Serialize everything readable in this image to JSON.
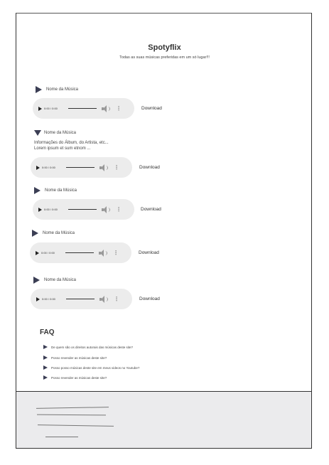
{
  "header": {
    "title": "Spotyflix",
    "subtitle": "Todas as suas músicas preferidas em um só lugar!!!"
  },
  "tracks": [
    {
      "name": "Nome da Música",
      "time": "0:00 / 0:00",
      "download": "Download"
    },
    {
      "name": "Nome da Música",
      "info_line1": "Informações do Álbum, do Artista, etc...",
      "info_line2": "Lorem ipsum et sum etnom ...",
      "time": "0:00 / 0:00",
      "download": "Download"
    },
    {
      "name": "Nome da Música",
      "time": "0:00 / 0:00",
      "download": "Download"
    },
    {
      "name": "Nome da Música",
      "time": "0:00 / 0:00",
      "download": "Download"
    },
    {
      "name": "Nome da Música",
      "time": "0:00 / 0:00",
      "download": "Download"
    }
  ],
  "faq": {
    "title": "FAQ",
    "items": [
      "De quem são os direitos autorais das músicas deste site?",
      "Posso revender as músicas deste site?",
      "Posso posso músicas deste site em meus videos no Youtube?",
      "Posso revender as músicas deste site?"
    ]
  },
  "icons": {
    "expand": "triangle-right-icon",
    "collapse": "triangle-down-icon",
    "play": "play-icon",
    "volume": "volume-icon",
    "more": "more-vertical-icon"
  },
  "colors": {
    "accent": "#3b3e54",
    "player_bg": "#ececec",
    "footer_bg": "#ebebed"
  }
}
